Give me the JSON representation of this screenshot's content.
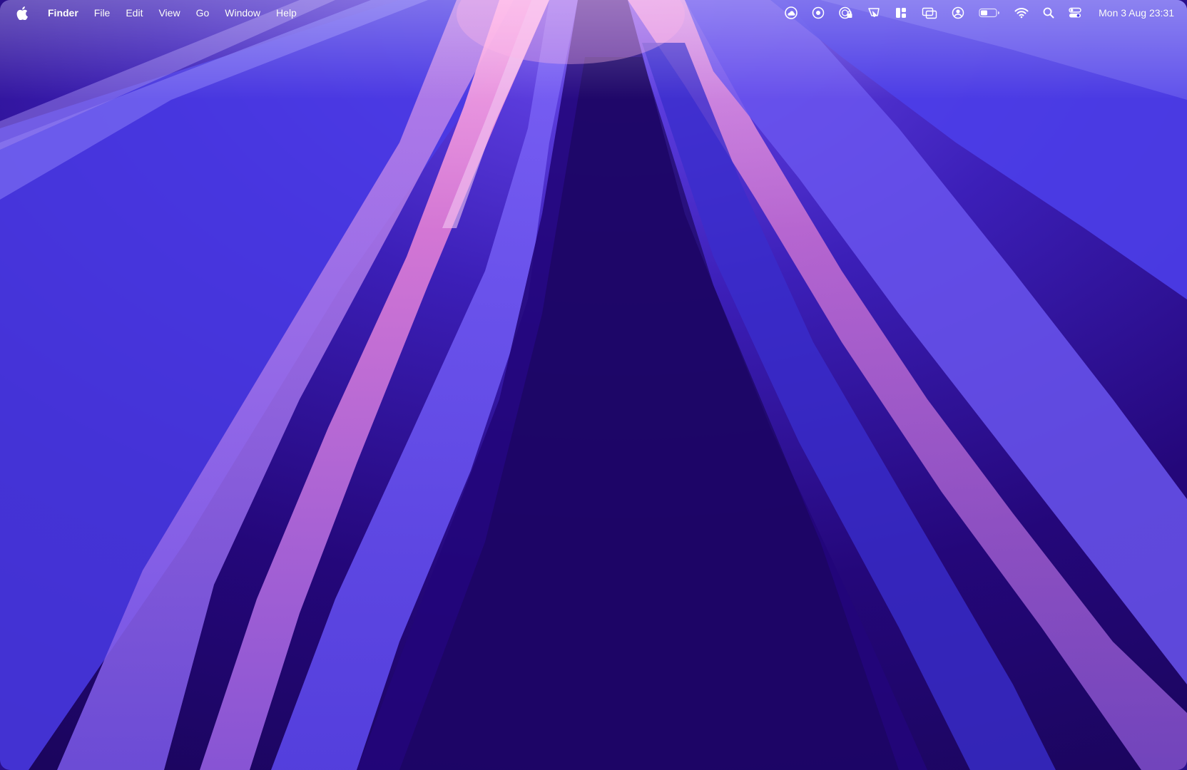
{
  "desktop": {
    "colors": {
      "base": "#24077a",
      "deep": "#1b055e",
      "violet": "#4b3ff0",
      "lavender": "#8a6af0",
      "pink": "#e37fd6"
    }
  },
  "menubar": {
    "apple_icon": "apple-logo-icon",
    "app_name": "Finder",
    "menus": [
      "File",
      "Edit",
      "View",
      "Go",
      "Window",
      "Help"
    ],
    "status_icons": [
      "creative-cloud-icon",
      "screen-record-icon",
      "vpn-lock-icon",
      "pen-tablet-icon",
      "window-layout-icon",
      "display-mirroring-icon",
      "user-account-icon",
      "battery-icon",
      "wifi-icon",
      "spotlight-search-icon",
      "control-center-icon"
    ],
    "battery_level": 0.45,
    "clock": "Mon 3 Aug  23:31"
  }
}
